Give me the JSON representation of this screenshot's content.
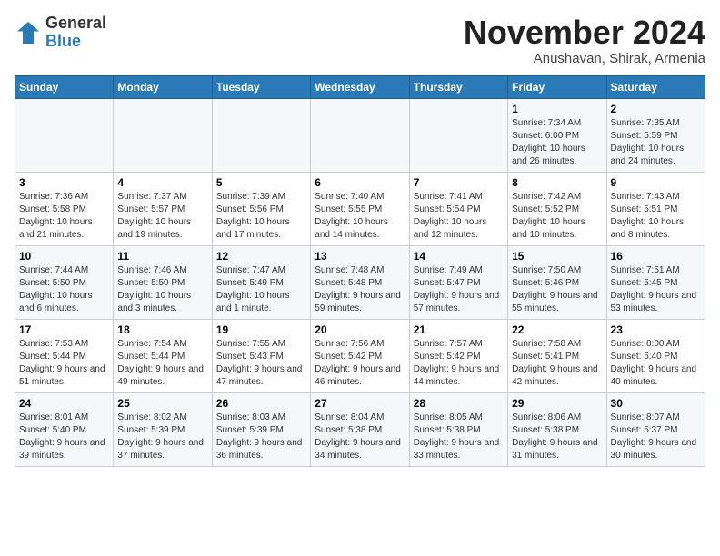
{
  "logo": {
    "general": "General",
    "blue": "Blue"
  },
  "title": "November 2024",
  "subtitle": "Anushavan, Shirak, Armenia",
  "days_header": [
    "Sunday",
    "Monday",
    "Tuesday",
    "Wednesday",
    "Thursday",
    "Friday",
    "Saturday"
  ],
  "weeks": [
    [
      {
        "day": "",
        "info": ""
      },
      {
        "day": "",
        "info": ""
      },
      {
        "day": "",
        "info": ""
      },
      {
        "day": "",
        "info": ""
      },
      {
        "day": "",
        "info": ""
      },
      {
        "day": "1",
        "info": "Sunrise: 7:34 AM\nSunset: 6:00 PM\nDaylight: 10 hours and 26 minutes."
      },
      {
        "day": "2",
        "info": "Sunrise: 7:35 AM\nSunset: 5:59 PM\nDaylight: 10 hours and 24 minutes."
      }
    ],
    [
      {
        "day": "3",
        "info": "Sunrise: 7:36 AM\nSunset: 5:58 PM\nDaylight: 10 hours and 21 minutes."
      },
      {
        "day": "4",
        "info": "Sunrise: 7:37 AM\nSunset: 5:57 PM\nDaylight: 10 hours and 19 minutes."
      },
      {
        "day": "5",
        "info": "Sunrise: 7:39 AM\nSunset: 5:56 PM\nDaylight: 10 hours and 17 minutes."
      },
      {
        "day": "6",
        "info": "Sunrise: 7:40 AM\nSunset: 5:55 PM\nDaylight: 10 hours and 14 minutes."
      },
      {
        "day": "7",
        "info": "Sunrise: 7:41 AM\nSunset: 5:54 PM\nDaylight: 10 hours and 12 minutes."
      },
      {
        "day": "8",
        "info": "Sunrise: 7:42 AM\nSunset: 5:52 PM\nDaylight: 10 hours and 10 minutes."
      },
      {
        "day": "9",
        "info": "Sunrise: 7:43 AM\nSunset: 5:51 PM\nDaylight: 10 hours and 8 minutes."
      }
    ],
    [
      {
        "day": "10",
        "info": "Sunrise: 7:44 AM\nSunset: 5:50 PM\nDaylight: 10 hours and 6 minutes."
      },
      {
        "day": "11",
        "info": "Sunrise: 7:46 AM\nSunset: 5:50 PM\nDaylight: 10 hours and 3 minutes."
      },
      {
        "day": "12",
        "info": "Sunrise: 7:47 AM\nSunset: 5:49 PM\nDaylight: 10 hours and 1 minute."
      },
      {
        "day": "13",
        "info": "Sunrise: 7:48 AM\nSunset: 5:48 PM\nDaylight: 9 hours and 59 minutes."
      },
      {
        "day": "14",
        "info": "Sunrise: 7:49 AM\nSunset: 5:47 PM\nDaylight: 9 hours and 57 minutes."
      },
      {
        "day": "15",
        "info": "Sunrise: 7:50 AM\nSunset: 5:46 PM\nDaylight: 9 hours and 55 minutes."
      },
      {
        "day": "16",
        "info": "Sunrise: 7:51 AM\nSunset: 5:45 PM\nDaylight: 9 hours and 53 minutes."
      }
    ],
    [
      {
        "day": "17",
        "info": "Sunrise: 7:53 AM\nSunset: 5:44 PM\nDaylight: 9 hours and 51 minutes."
      },
      {
        "day": "18",
        "info": "Sunrise: 7:54 AM\nSunset: 5:44 PM\nDaylight: 9 hours and 49 minutes."
      },
      {
        "day": "19",
        "info": "Sunrise: 7:55 AM\nSunset: 5:43 PM\nDaylight: 9 hours and 47 minutes."
      },
      {
        "day": "20",
        "info": "Sunrise: 7:56 AM\nSunset: 5:42 PM\nDaylight: 9 hours and 46 minutes."
      },
      {
        "day": "21",
        "info": "Sunrise: 7:57 AM\nSunset: 5:42 PM\nDaylight: 9 hours and 44 minutes."
      },
      {
        "day": "22",
        "info": "Sunrise: 7:58 AM\nSunset: 5:41 PM\nDaylight: 9 hours and 42 minutes."
      },
      {
        "day": "23",
        "info": "Sunrise: 8:00 AM\nSunset: 5:40 PM\nDaylight: 9 hours and 40 minutes."
      }
    ],
    [
      {
        "day": "24",
        "info": "Sunrise: 8:01 AM\nSunset: 5:40 PM\nDaylight: 9 hours and 39 minutes."
      },
      {
        "day": "25",
        "info": "Sunrise: 8:02 AM\nSunset: 5:39 PM\nDaylight: 9 hours and 37 minutes."
      },
      {
        "day": "26",
        "info": "Sunrise: 8:03 AM\nSunset: 5:39 PM\nDaylight: 9 hours and 36 minutes."
      },
      {
        "day": "27",
        "info": "Sunrise: 8:04 AM\nSunset: 5:38 PM\nDaylight: 9 hours and 34 minutes."
      },
      {
        "day": "28",
        "info": "Sunrise: 8:05 AM\nSunset: 5:38 PM\nDaylight: 9 hours and 33 minutes."
      },
      {
        "day": "29",
        "info": "Sunrise: 8:06 AM\nSunset: 5:38 PM\nDaylight: 9 hours and 31 minutes."
      },
      {
        "day": "30",
        "info": "Sunrise: 8:07 AM\nSunset: 5:37 PM\nDaylight: 9 hours and 30 minutes."
      }
    ]
  ]
}
